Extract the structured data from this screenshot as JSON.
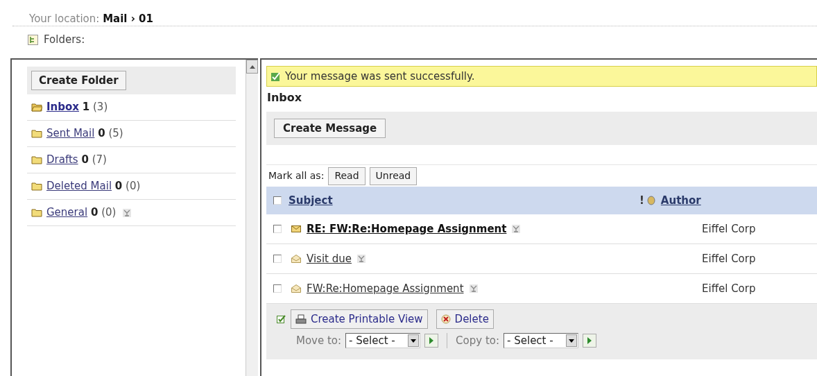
{
  "breadcrumb": {
    "label": "Your location:",
    "path": "Mail › 01"
  },
  "folders_label": "Folders:",
  "sidebar": {
    "create_button": "Create Folder",
    "folders": [
      {
        "name": "Inbox",
        "unread": "1",
        "total": "(3)",
        "selected": true,
        "has_filter": false
      },
      {
        "name": "Sent Mail",
        "unread": "0",
        "total": "(5)",
        "selected": false,
        "has_filter": false
      },
      {
        "name": "Drafts",
        "unread": "0",
        "total": "(7)",
        "selected": false,
        "has_filter": false
      },
      {
        "name": "Deleted Mail",
        "unread": "0",
        "total": "(0)",
        "selected": false,
        "has_filter": false
      },
      {
        "name": "General",
        "unread": "0",
        "total": "(0)",
        "selected": false,
        "has_filter": true
      }
    ]
  },
  "notice": "Your message was sent successfully.",
  "heading": "Inbox",
  "create_message": "Create Message",
  "mark_all": {
    "label": "Mark all as:",
    "buttons": [
      "Read",
      "Unread"
    ]
  },
  "table": {
    "select_all_checked": false,
    "columns": {
      "subject": "Subject",
      "priority": "!",
      "author": "Author"
    },
    "rows": [
      {
        "subject": "RE: FW:Re:Homepage Assignment",
        "author": "Eiffel Corp",
        "unread": true,
        "checked": false
      },
      {
        "subject": "Visit due",
        "author": "Eiffel Corp",
        "unread": false,
        "checked": false
      },
      {
        "subject": "FW:Re:Homepage Assignment",
        "author": "Eiffel Corp",
        "unread": false,
        "checked": false
      }
    ]
  },
  "actions": {
    "printable": "Create Printable View",
    "delete": "Delete",
    "move_label": "Move to:",
    "move_value": "- Select -",
    "copy_label": "Copy to:",
    "copy_value": "- Select -"
  }
}
